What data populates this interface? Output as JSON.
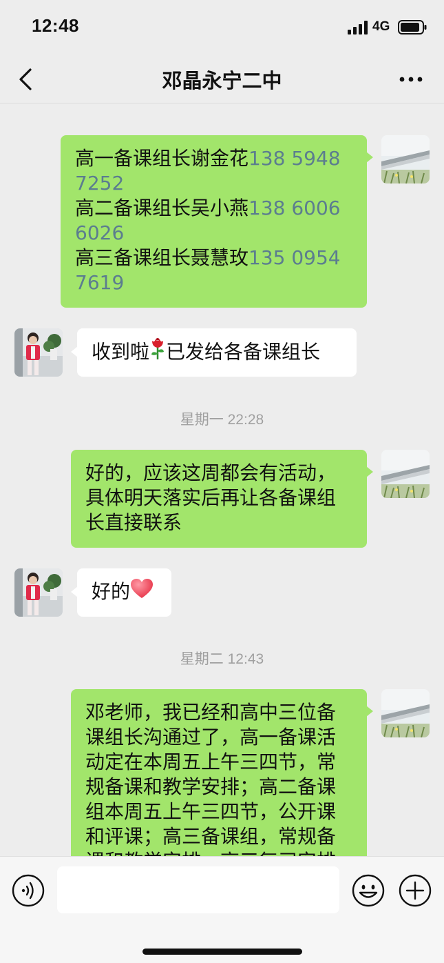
{
  "status_bar": {
    "time": "12:48",
    "network": "4G"
  },
  "nav": {
    "title": "邓晶永宁二中"
  },
  "messages": {
    "m1": {
      "sender": "me",
      "lines": [
        {
          "text": "高一备课组长谢金花",
          "phone": "138 5948"
        },
        {
          "text": "",
          "phone": "7252"
        },
        {
          "text": "高二备课组长吴小燕",
          "phone": "138 6006"
        },
        {
          "text": "",
          "phone": "6026"
        },
        {
          "text": "高三备课组长聂慧玫",
          "phone": "135 0954"
        },
        {
          "text": "",
          "phone": "7619"
        }
      ]
    },
    "m2": {
      "sender": "them",
      "before": "收到啦",
      "emoji": "rose-emoji",
      "after": "已发给各备课组长"
    },
    "t1": "星期一 22:28",
    "m3": {
      "sender": "me",
      "lines": [
        "好的，应该这周都会有活动，",
        "具体明天落实后再让各备课组",
        "长直接联系"
      ]
    },
    "m4": {
      "sender": "them",
      "text": "好的",
      "emoji": "heart-emoji"
    },
    "t2": "星期二 12:43",
    "m5": {
      "sender": "me",
      "lines": [
        "邓老师，我已经和高中三位备",
        "课组长沟通过了，高一备课活",
        "动定在本周五上午三四节，常",
        "规备课和教学安排；高二备课",
        "组本周五上午三四节，公开课",
        "和评课；高三备课组，常规备",
        "课和教学安排，高三复习安排"
      ]
    }
  },
  "input_bar": {
    "value": "",
    "icons": [
      "voice-icon",
      "emoji-icon",
      "plus-icon"
    ]
  },
  "colors": {
    "me_bubble": "#a2e56b",
    "them_bubble": "#ffffff",
    "phone_link": "#5b7d8f",
    "background": "#ededed"
  }
}
